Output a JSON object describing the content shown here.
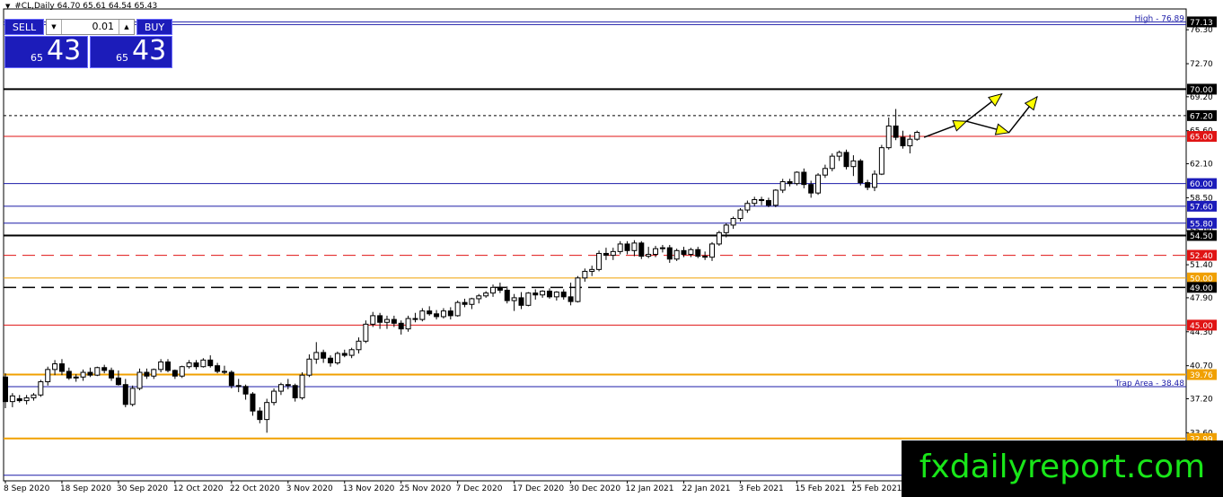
{
  "header": {
    "symbol_text": "#CL,Daily",
    "ohlc_text": "64.70 65.61 64.54 65.43"
  },
  "trade_panel": {
    "sell_label": "SELL",
    "buy_label": "BUY",
    "lot_value": "0.01",
    "sell_small": "65",
    "sell_big": "43",
    "buy_small": "65",
    "buy_big": "43"
  },
  "watermark": "fxdailyreport.com",
  "colors": {
    "up_fill": "#ffffff",
    "down_fill": "#000000",
    "candle_line": "#000000",
    "blue_line": "#1c1ca8",
    "red_line": "#e01414",
    "orange_line": "#f0a000",
    "arrow_fill": "#ffff00",
    "label_blue_bg": "#1c1cba",
    "label_red_bg": "#e01414",
    "label_orange_bg": "#f0a000",
    "label_black_bg": "#000000"
  },
  "chart_data": {
    "type": "candlestick",
    "title": "#CL,Daily",
    "ylim": [
      28.5,
      78.5
    ],
    "y_ticks": [
      "76.30",
      "72.70",
      "69.20",
      "65.60",
      "62.10",
      "58.50",
      "55.00",
      "51.40",
      "47.90",
      "44.30",
      "40.70",
      "37.20",
      "33.60",
      "30.10"
    ],
    "x_ticks": [
      {
        "label": "8 Sep 2020",
        "index": 0
      },
      {
        "label": "18 Sep 2020",
        "index": 8
      },
      {
        "label": "30 Sep 2020",
        "index": 16
      },
      {
        "label": "12 Oct 2020",
        "index": 24
      },
      {
        "label": "22 Oct 2020",
        "index": 32
      },
      {
        "label": "3 Nov 2020",
        "index": 40
      },
      {
        "label": "13 Nov 2020",
        "index": 48
      },
      {
        "label": "25 Nov 2020",
        "index": 56
      },
      {
        "label": "7 Dec 2020",
        "index": 64
      },
      {
        "label": "17 Dec 2020",
        "index": 72
      },
      {
        "label": "30 Dec 2020",
        "index": 80
      },
      {
        "label": "12 Jan 2021",
        "index": 88
      },
      {
        "label": "22 Jan 2021",
        "index": 96
      },
      {
        "label": "3 Feb 2021",
        "index": 104
      },
      {
        "label": "15 Feb 2021",
        "index": 112
      },
      {
        "label": "25 Feb 2021",
        "index": 120
      }
    ],
    "candles": [
      [
        39.5,
        39.9,
        36.2,
        36.9
      ],
      [
        36.9,
        37.8,
        36.3,
        37.5
      ],
      [
        37.2,
        37.6,
        36.8,
        37.0
      ],
      [
        37.0,
        37.6,
        36.6,
        37.3
      ],
      [
        37.3,
        37.8,
        37.0,
        37.6
      ],
      [
        37.6,
        39.2,
        37.4,
        39.0
      ],
      [
        39.0,
        40.6,
        38.6,
        40.3
      ],
      [
        40.3,
        41.3,
        39.7,
        40.9
      ],
      [
        40.9,
        41.4,
        39.7,
        40.1
      ],
      [
        40.1,
        40.5,
        39.2,
        39.4
      ],
      [
        39.4,
        39.8,
        39.0,
        39.5
      ],
      [
        39.5,
        40.3,
        39.1,
        40.0
      ],
      [
        40.0,
        40.5,
        39.5,
        39.7
      ],
      [
        39.7,
        40.6,
        39.6,
        40.5
      ],
      [
        40.5,
        40.8,
        39.9,
        40.2
      ],
      [
        40.2,
        40.5,
        39.1,
        39.4
      ],
      [
        39.4,
        40.2,
        38.6,
        38.7
      ],
      [
        38.7,
        39.3,
        36.3,
        36.6
      ],
      [
        36.6,
        38.6,
        36.4,
        38.3
      ],
      [
        38.3,
        40.4,
        38.1,
        40.0
      ],
      [
        40.0,
        40.4,
        39.3,
        39.6
      ],
      [
        39.6,
        40.4,
        39.3,
        40.3
      ],
      [
        40.3,
        41.4,
        40.0,
        41.1
      ],
      [
        41.1,
        41.4,
        40.0,
        40.2
      ],
      [
        40.2,
        40.3,
        39.3,
        39.6
      ],
      [
        39.6,
        40.7,
        39.4,
        40.6
      ],
      [
        40.6,
        41.3,
        40.4,
        41.0
      ],
      [
        41.0,
        41.3,
        40.3,
        40.6
      ],
      [
        40.6,
        41.5,
        40.5,
        41.3
      ],
      [
        41.3,
        41.8,
        40.5,
        40.7
      ],
      [
        40.7,
        41.0,
        39.9,
        40.1
      ],
      [
        40.1,
        40.7,
        39.8,
        40.0
      ],
      [
        40.0,
        40.2,
        38.3,
        38.6
      ],
      [
        38.6,
        39.3,
        37.9,
        38.5
      ],
      [
        38.5,
        38.7,
        37.1,
        37.7
      ],
      [
        37.7,
        37.9,
        35.4,
        35.9
      ],
      [
        35.9,
        36.3,
        34.6,
        35.0
      ],
      [
        35.0,
        37.2,
        33.6,
        36.8
      ],
      [
        36.8,
        38.3,
        36.5,
        38.0
      ],
      [
        38.0,
        38.9,
        37.6,
        38.7
      ],
      [
        38.7,
        39.3,
        38.2,
        38.6
      ],
      [
        38.6,
        38.8,
        36.9,
        37.3
      ],
      [
        37.3,
        40.0,
        37.1,
        39.7
      ],
      [
        39.7,
        41.9,
        39.5,
        41.4
      ],
      [
        41.4,
        43.2,
        40.9,
        42.1
      ],
      [
        42.1,
        42.4,
        41.0,
        41.5
      ],
      [
        41.5,
        41.8,
        40.6,
        41.0
      ],
      [
        41.0,
        42.2,
        40.8,
        42.0
      ],
      [
        42.0,
        42.4,
        41.6,
        41.8
      ],
      [
        41.8,
        42.6,
        41.5,
        42.4
      ],
      [
        42.4,
        43.7,
        42.0,
        43.3
      ],
      [
        43.3,
        45.5,
        43.1,
        45.1
      ],
      [
        45.1,
        46.4,
        44.8,
        46.0
      ],
      [
        46.0,
        46.3,
        44.6,
        45.3
      ],
      [
        45.3,
        46.0,
        44.6,
        45.6
      ],
      [
        45.6,
        46.0,
        44.8,
        45.2
      ],
      [
        45.2,
        45.5,
        44.0,
        44.6
      ],
      [
        44.6,
        46.0,
        44.3,
        45.7
      ],
      [
        45.7,
        46.3,
        45.3,
        45.6
      ],
      [
        45.6,
        46.8,
        45.4,
        46.5
      ],
      [
        46.5,
        47.0,
        46.0,
        46.2
      ],
      [
        46.2,
        46.6,
        45.6,
        45.9
      ],
      [
        45.9,
        46.8,
        45.7,
        46.5
      ],
      [
        46.5,
        46.9,
        45.6,
        46.0
      ],
      [
        46.0,
        47.6,
        45.9,
        47.4
      ],
      [
        47.4,
        47.8,
        46.9,
        47.2
      ],
      [
        47.2,
        47.9,
        46.7,
        47.8
      ],
      [
        47.8,
        48.3,
        47.3,
        48.1
      ],
      [
        48.1,
        48.6,
        47.9,
        48.4
      ],
      [
        48.4,
        49.3,
        48.0,
        49.0
      ],
      [
        49.0,
        49.5,
        48.4,
        48.7
      ],
      [
        48.7,
        49.1,
        47.3,
        47.6
      ],
      [
        47.6,
        48.3,
        46.5,
        47.9
      ],
      [
        47.9,
        48.5,
        46.7,
        47.1
      ],
      [
        47.1,
        48.5,
        47.0,
        48.4
      ],
      [
        48.4,
        48.8,
        47.7,
        48.2
      ],
      [
        48.2,
        48.7,
        47.9,
        48.6
      ],
      [
        48.6,
        48.9,
        47.8,
        48.0
      ],
      [
        48.0,
        48.6,
        47.6,
        48.5
      ],
      [
        48.5,
        48.8,
        47.7,
        48.0
      ],
      [
        48.0,
        49.5,
        47.1,
        47.5
      ],
      [
        47.5,
        50.2,
        47.4,
        50.0
      ],
      [
        50.0,
        51.0,
        49.6,
        50.7
      ],
      [
        50.7,
        51.3,
        50.2,
        50.9
      ],
      [
        50.9,
        52.9,
        50.7,
        52.6
      ],
      [
        52.6,
        53.2,
        51.9,
        52.4
      ],
      [
        52.4,
        53.2,
        51.9,
        52.8
      ],
      [
        52.8,
        53.9,
        52.5,
        53.6
      ],
      [
        53.6,
        53.9,
        52.5,
        52.9
      ],
      [
        52.9,
        54.0,
        52.3,
        53.7
      ],
      [
        53.7,
        53.9,
        52.0,
        52.3
      ],
      [
        52.3,
        53.3,
        52.1,
        52.5
      ],
      [
        52.5,
        53.4,
        52.2,
        53.1
      ],
      [
        53.1,
        53.5,
        52.7,
        53.2
      ],
      [
        53.2,
        53.5,
        51.6,
        52.0
      ],
      [
        52.0,
        53.1,
        51.8,
        52.9
      ],
      [
        52.9,
        53.3,
        52.2,
        52.5
      ],
      [
        52.5,
        53.2,
        52.2,
        53.0
      ],
      [
        53.0,
        53.3,
        52.1,
        52.3
      ],
      [
        52.3,
        52.8,
        51.9,
        52.2
      ],
      [
        52.2,
        53.8,
        51.8,
        53.6
      ],
      [
        53.6,
        55.0,
        53.4,
        54.8
      ],
      [
        54.8,
        55.8,
        54.3,
        55.6
      ],
      [
        55.6,
        56.5,
        55.2,
        56.3
      ],
      [
        56.3,
        57.4,
        56.0,
        57.2
      ],
      [
        57.2,
        58.2,
        56.9,
        57.9
      ],
      [
        57.9,
        58.6,
        57.6,
        58.3
      ],
      [
        58.3,
        58.6,
        57.7,
        58.2
      ],
      [
        58.2,
        58.5,
        57.5,
        57.7
      ],
      [
        57.7,
        59.4,
        57.5,
        59.3
      ],
      [
        59.3,
        60.5,
        59.0,
        60.2
      ],
      [
        60.2,
        60.5,
        59.7,
        60.0
      ],
      [
        60.0,
        61.3,
        59.8,
        61.2
      ],
      [
        61.2,
        61.6,
        59.5,
        59.9
      ],
      [
        59.9,
        60.3,
        58.5,
        59.0
      ],
      [
        59.0,
        61.1,
        58.8,
        60.9
      ],
      [
        60.9,
        62.0,
        60.6,
        61.6
      ],
      [
        61.6,
        63.2,
        61.3,
        62.9
      ],
      [
        62.9,
        63.5,
        62.4,
        63.3
      ],
      [
        63.3,
        63.6,
        61.5,
        61.8
      ],
      [
        61.8,
        63.0,
        60.8,
        62.4
      ],
      [
        62.4,
        62.6,
        59.8,
        60.1
      ],
      [
        60.1,
        60.4,
        59.3,
        59.6
      ],
      [
        59.6,
        61.4,
        59.2,
        61.0
      ],
      [
        61.0,
        64.1,
        60.9,
        63.8
      ],
      [
        63.8,
        67.0,
        63.6,
        66.1
      ],
      [
        66.1,
        67.9,
        64.6,
        64.9
      ],
      [
        64.9,
        65.6,
        63.7,
        64.0
      ],
      [
        64.0,
        65.2,
        63.2,
        64.7
      ],
      [
        64.7,
        65.61,
        64.54,
        65.43
      ]
    ],
    "levels": [
      {
        "value": 77.13,
        "style": "double-blue",
        "label": "77.13",
        "label_style": "black",
        "note": "High - 76.89"
      },
      {
        "value": 70.0,
        "style": "thick-black",
        "label": "70.00",
        "label_style": "black"
      },
      {
        "value": 67.2,
        "style": "dotted-black",
        "label": "67.20",
        "label_style": "black"
      },
      {
        "value": 65.0,
        "style": "red",
        "label": "65.00",
        "label_style": "red"
      },
      {
        "value": 60.0,
        "style": "blue",
        "label": "60.00",
        "label_style": "blue"
      },
      {
        "value": 57.6,
        "style": "blue",
        "label": "57.60",
        "label_style": "blue"
      },
      {
        "value": 55.8,
        "style": "blue",
        "label": "55.80",
        "label_style": "blue"
      },
      {
        "value": 54.5,
        "style": "thick-black",
        "label": "54.50",
        "label_style": "black"
      },
      {
        "value": 52.4,
        "style": "dashed-red",
        "label": "52.40",
        "label_style": "red"
      },
      {
        "value": 50.0,
        "style": "orange",
        "label": "50.00",
        "label_style": "orange"
      },
      {
        "value": 49.0,
        "style": "dashed-black",
        "label": "49.00",
        "label_style": "black"
      },
      {
        "value": 45.0,
        "style": "red",
        "label": "45.00",
        "label_style": "red"
      },
      {
        "value": 39.76,
        "style": "thick-orange",
        "label": "39.76",
        "label_style": "orange"
      },
      {
        "value": 38.48,
        "style": "blue",
        "label": "",
        "label_style": "none",
        "note": "Trap Area - 38.48"
      },
      {
        "value": 32.99,
        "style": "thick-orange",
        "label": "32.99",
        "label_style": "orange"
      },
      {
        "value": 29.1,
        "style": "blue",
        "label": "",
        "label_style": "none"
      }
    ],
    "projection_arrows": [
      [
        [
          130,
          64.9
        ],
        [
          136,
          66.6
        ]
      ],
      [
        [
          136,
          66.6
        ],
        [
          141,
          69.5
        ]
      ],
      [
        [
          136,
          66.6
        ],
        [
          142,
          65.4
        ]
      ],
      [
        [
          142,
          65.4
        ],
        [
          146,
          69.2
        ]
      ]
    ]
  }
}
